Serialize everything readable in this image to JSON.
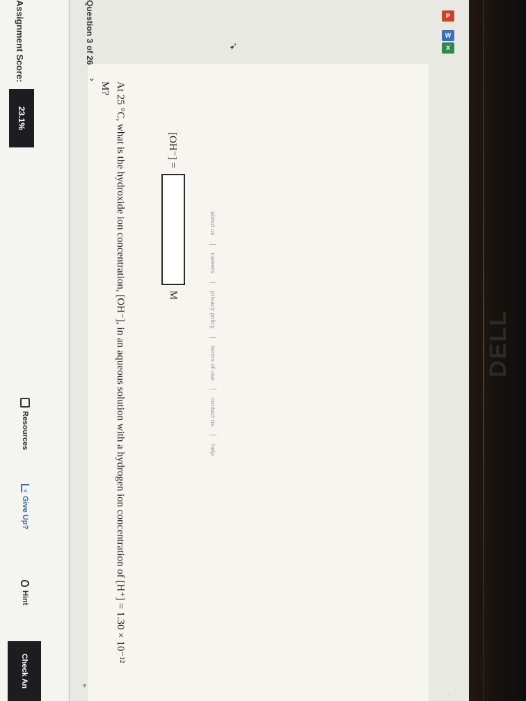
{
  "header": {
    "score_label": "Assignment Score:",
    "score_value": "23.1%",
    "question_nav": "Question 3 of 26",
    "resources_label": "Resources",
    "give_up_label": "Give Up?",
    "hint_label": "Hint",
    "check_answer_label": "Check An"
  },
  "question": {
    "text": "At 25 °C, what is the hydroxide ion concentration, [OH⁻], in an aqueous solution with a hydrogen ion concentration of [H⁺] = 1.30 × 10⁻¹² M?",
    "answer_label": "[OH⁻] =",
    "answer_value": "",
    "answer_unit": "M"
  },
  "footer": {
    "links": [
      "about us",
      "careers",
      "privacy policy",
      "terms of use",
      "contact us",
      "help"
    ]
  },
  "monitor": {
    "brand": "DELL"
  },
  "taskbar": {
    "ppt_label": "P",
    "word_label": "W",
    "excel_label": "X",
    "chevron": "^"
  },
  "colors": {
    "accent_dark": "#1d1d1f",
    "give_up_blue": "#3a6fa8",
    "panel_bg": "#f6f5ef"
  }
}
